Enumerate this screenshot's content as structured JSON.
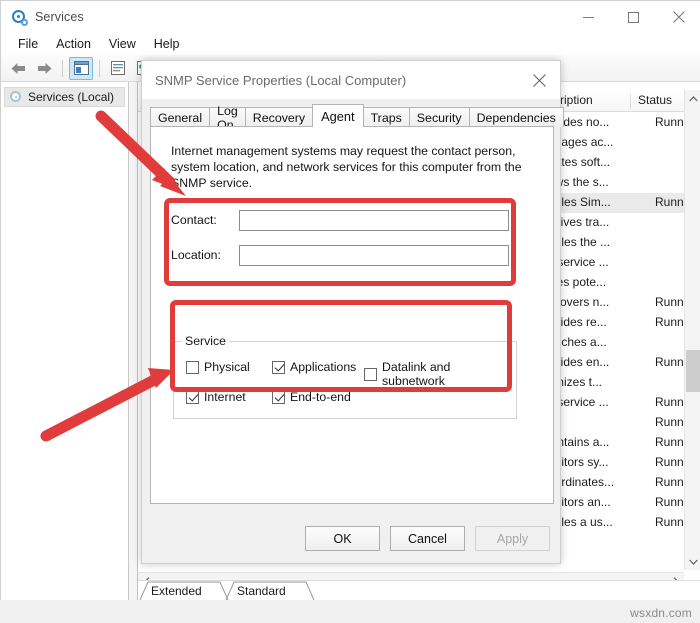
{
  "window": {
    "title": "Services",
    "title_icon": "services-gear-icon",
    "controls": {
      "minimize": "minimize-icon",
      "maximize": "maximize-icon",
      "close": "close-icon"
    },
    "menu": [
      "File",
      "Action",
      "View",
      "Help"
    ],
    "toolbar_icons": [
      "back-arrow-icon",
      "forward-arrow-icon",
      "show-tree-icon",
      "properties-icon",
      "refresh-icon",
      "export-list-icon",
      "start-service-icon"
    ]
  },
  "sidebar": {
    "items": [
      {
        "label": "Services (Local)",
        "icon": "services-gear-icon"
      }
    ]
  },
  "services_list": {
    "columns": [
      "scription",
      "Status"
    ],
    "rows": [
      {
        "description": "ovides no...",
        "status": "Running",
        "selected": false
      },
      {
        "description": "anages ac...",
        "status": "",
        "selected": false
      },
      {
        "description": "eates soft...",
        "status": "",
        "selected": false
      },
      {
        "description": "ows the s...",
        "status": "",
        "selected": false
      },
      {
        "description": "ables Sim...",
        "status": "Running",
        "selected": true
      },
      {
        "description": "ceives tra...",
        "status": "",
        "selected": false
      },
      {
        "description": "ables the ...",
        "status": "",
        "selected": false
      },
      {
        "description": "s service ...",
        "status": "",
        "selected": false
      },
      {
        "description": "ifies pote...",
        "status": "",
        "selected": false
      },
      {
        "description": "scovers n...",
        "status": "Running",
        "selected": false
      },
      {
        "description": "ovides re...",
        "status": "Running",
        "selected": false
      },
      {
        "description": "unches a...",
        "status": "",
        "selected": false
      },
      {
        "description": "ovides en...",
        "status": "Running",
        "selected": false
      },
      {
        "description": "timizes t...",
        "status": "",
        "selected": false
      },
      {
        "description": "s service ...",
        "status": "Running",
        "selected": false
      },
      {
        "description": "",
        "status": "Running",
        "selected": false
      },
      {
        "description": "aintains a...",
        "status": "Running",
        "selected": false
      },
      {
        "description": "onitors sy...",
        "status": "Running",
        "selected": false
      },
      {
        "description": "oordinates...",
        "status": "Running",
        "selected": false
      },
      {
        "description": "onitors an...",
        "status": "Running",
        "selected": false
      },
      {
        "description": "ables a us...",
        "status": "Running",
        "selected": false
      }
    ],
    "scroll_up_icon": "chevron-up-icon",
    "scroll_down_icon": "chevron-down-icon",
    "scroll_left_icon": "chevron-left-icon",
    "scroll_right_icon": "chevron-right-icon"
  },
  "view_tabs": [
    {
      "label": "Extended",
      "active": false
    },
    {
      "label": "Standard",
      "active": true
    }
  ],
  "dialog": {
    "title": "SNMP Service Properties (Local Computer)",
    "close_icon": "close-icon",
    "tabs": [
      {
        "label": "General",
        "active": false
      },
      {
        "label": "Log On",
        "active": false
      },
      {
        "label": "Recovery",
        "active": false
      },
      {
        "label": "Agent",
        "active": true
      },
      {
        "label": "Traps",
        "active": false
      },
      {
        "label": "Security",
        "active": false
      },
      {
        "label": "Dependencies",
        "active": false
      }
    ],
    "agent": {
      "description": "Internet management systems may request the contact person, system location, and network services for this computer from the SNMP service.",
      "contact_label": "Contact:",
      "contact_value": "",
      "location_label": "Location:",
      "location_value": "",
      "service_group_label": "Service",
      "checkboxes": [
        {
          "label": "Physical",
          "checked": false
        },
        {
          "label": "Applications",
          "checked": true
        },
        {
          "label": "Datalink and subnetwork",
          "checked": false
        },
        {
          "label": "Internet",
          "checked": true
        },
        {
          "label": "End-to-end",
          "checked": true
        }
      ]
    },
    "buttons": [
      {
        "label": "OK",
        "disabled": false
      },
      {
        "label": "Cancel",
        "disabled": false
      },
      {
        "label": "Apply",
        "disabled": true
      }
    ]
  },
  "annotations": {
    "color": "#e03c3c",
    "highlight_boxes": [
      "contact-location-fields",
      "service-checkbox-group"
    ],
    "arrows": [
      "arrow-to-contact-fields",
      "arrow-to-service-group"
    ]
  },
  "watermark": {
    "text": "wsxdn.com"
  }
}
